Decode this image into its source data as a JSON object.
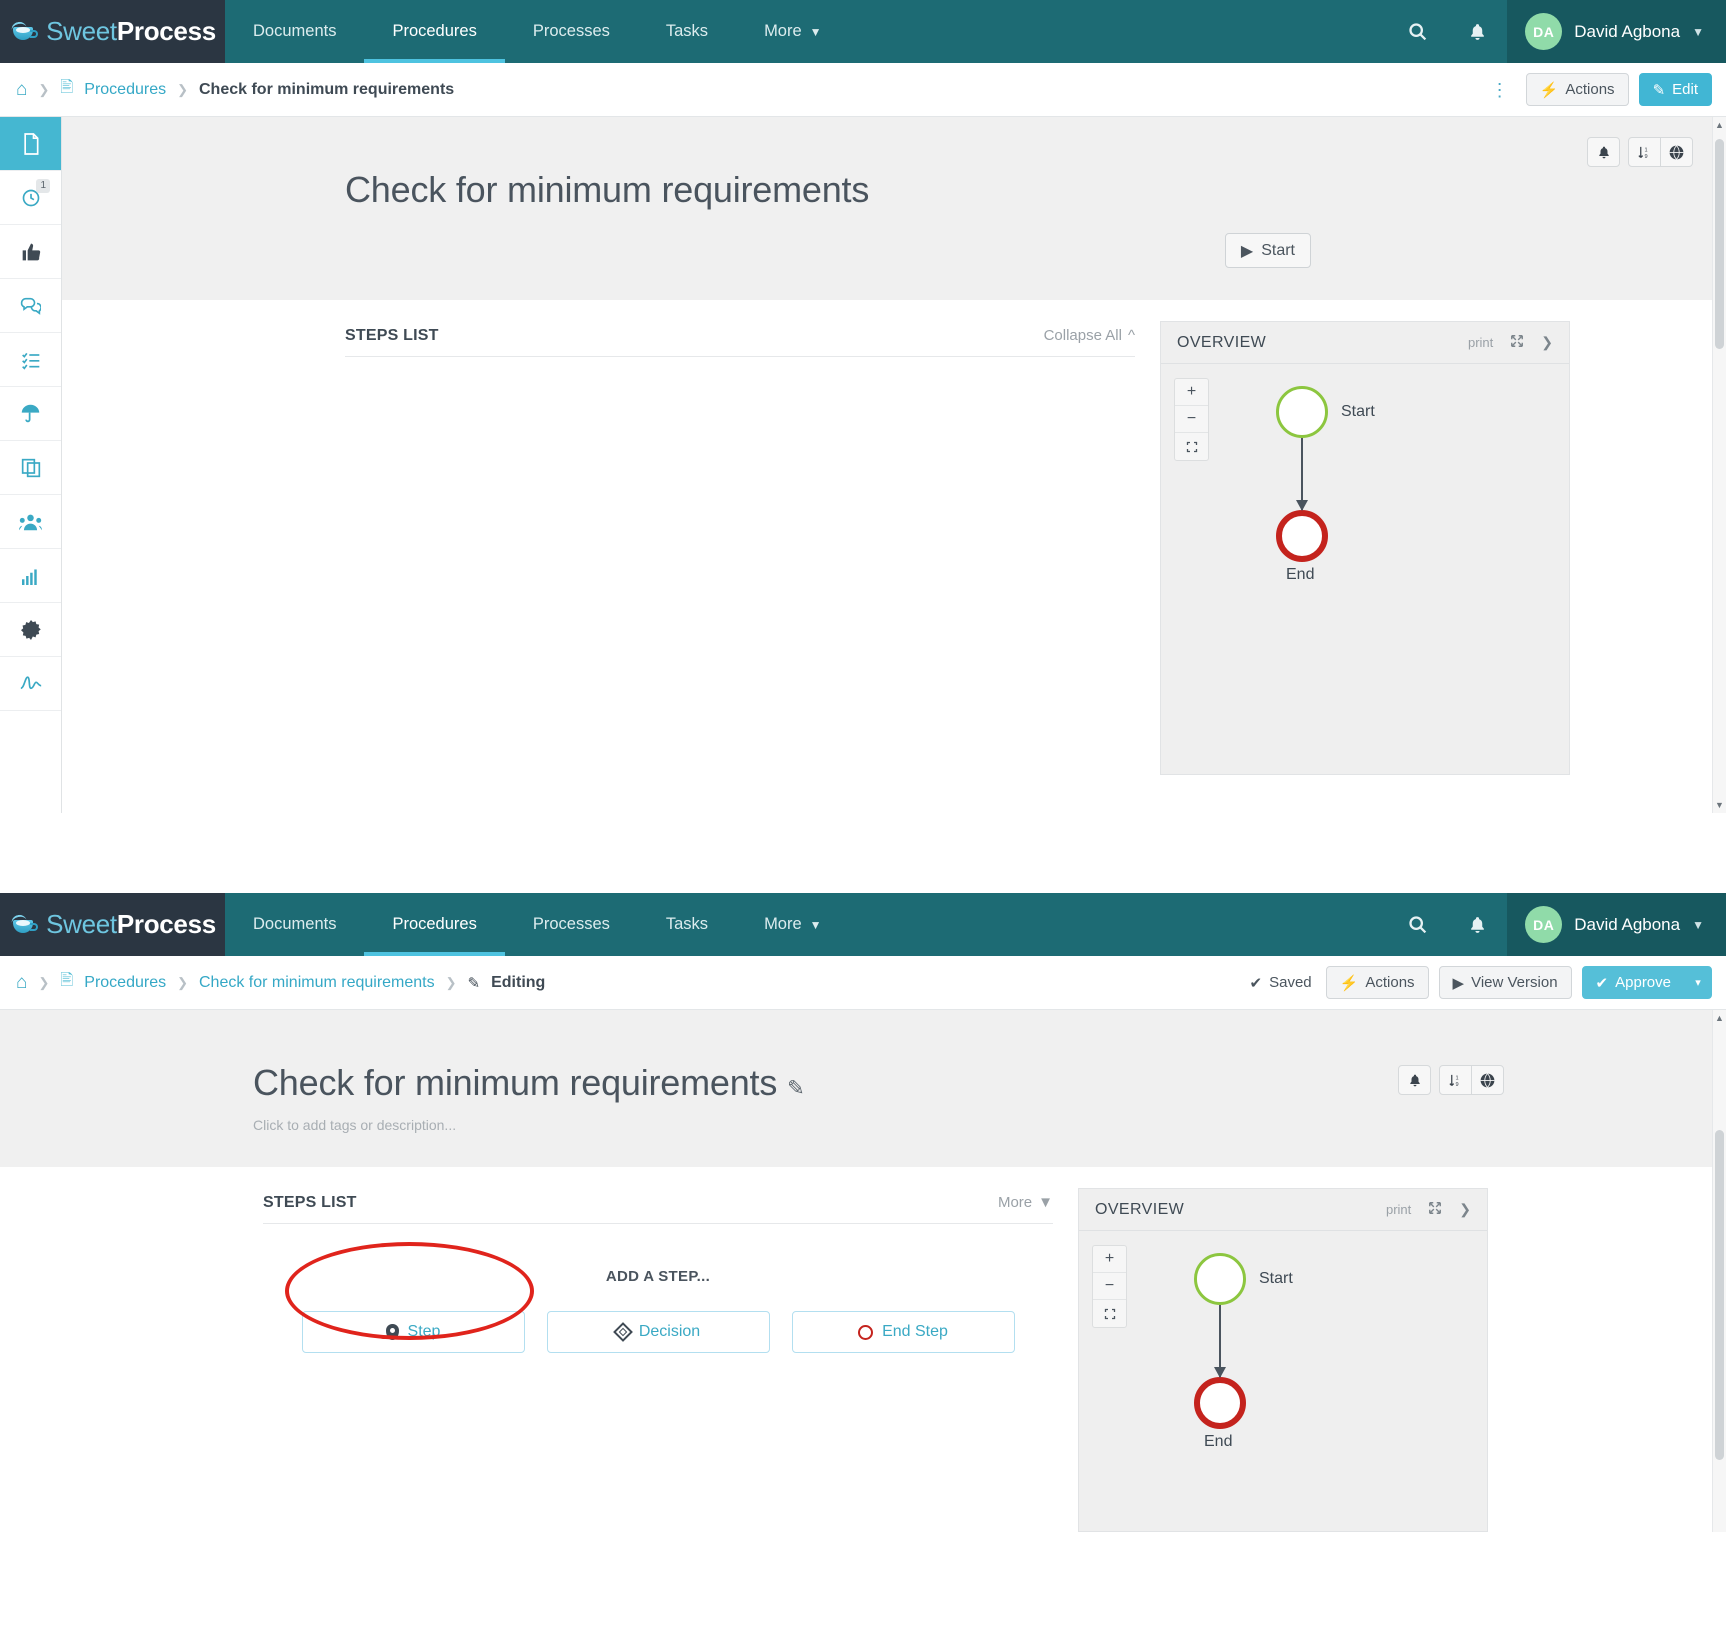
{
  "brand": {
    "sweet": "Sweet",
    "process": "Process",
    "mark": "coffee-cup-logo"
  },
  "nav": {
    "links": [
      {
        "label": "Documents",
        "active": false
      },
      {
        "label": "Procedures",
        "active": true
      },
      {
        "label": "Processes",
        "active": false
      },
      {
        "label": "Tasks",
        "active": false
      },
      {
        "label": "More",
        "active": false,
        "caret": "⌄"
      }
    ],
    "search_icon": "search-icon",
    "bell_icon": "bell-icon",
    "user": {
      "initials": "DA",
      "name": "David Agbona",
      "caret": "⌄"
    }
  },
  "sidebar": {
    "items": [
      {
        "name": "documents",
        "glyph": "📄",
        "active": true,
        "badge": ""
      },
      {
        "name": "history",
        "glyph": "◴",
        "active": false,
        "badge": "1"
      },
      {
        "name": "approvals",
        "glyph": "👍",
        "active": false,
        "badge": ""
      },
      {
        "name": "comments",
        "glyph": "💬",
        "active": false,
        "badge": ""
      },
      {
        "name": "checklist",
        "glyph": "☰",
        "active": false,
        "badge": ""
      },
      {
        "name": "umbrella",
        "glyph": "☂",
        "active": false,
        "badge": ""
      },
      {
        "name": "duplicate",
        "glyph": "❐",
        "active": false,
        "badge": ""
      },
      {
        "name": "teams",
        "glyph": "👥",
        "active": false,
        "badge": ""
      },
      {
        "name": "reports",
        "glyph": "📶",
        "active": false,
        "badge": ""
      },
      {
        "name": "settings",
        "glyph": "⚙",
        "active": false,
        "badge": ""
      },
      {
        "name": "signature",
        "glyph": "∿",
        "active": false,
        "badge": ""
      }
    ]
  },
  "view_panel": {
    "breadcrumb": {
      "home": "⌂",
      "doc_icon": "📄",
      "link": "Procedures",
      "current": "Check for minimum requirements"
    },
    "actions": {
      "kebab": "⋮",
      "actions_label": "Actions",
      "actions_icon": "bolt-icon",
      "edit_label": "Edit",
      "edit_icon": "pencil-square-icon"
    },
    "tools": [
      {
        "name": "notify",
        "glyph": "🔔"
      },
      {
        "name": "sort",
        "glyph": "↓"
      },
      {
        "name": "globe",
        "glyph": "🌐"
      }
    ],
    "title": "Check for minimum requirements",
    "start_button": "Start",
    "steps": {
      "title": "STEPS LIST",
      "action": "Collapse All",
      "caret": "⌃"
    },
    "overview": {
      "title": "OVERVIEW",
      "print": "print",
      "expand_icon": "expand-icon",
      "next_icon": "chevron-right-icon",
      "zoom_in": "+",
      "zoom_out": "−",
      "fit": "⛶",
      "start_label": "Start",
      "end_label": "End"
    }
  },
  "edit_panel": {
    "breadcrumb": {
      "home": "⌂",
      "doc_icon": "📄",
      "link": "Procedures",
      "doc_link": "Check for minimum requirements",
      "editing_icon": "✎",
      "editing": "Editing"
    },
    "actions": {
      "saved_check": "✔",
      "saved": "Saved",
      "actions_label": "Actions",
      "view_version_label": "View Version",
      "approve_label": "Approve",
      "approve_caret": "▾"
    },
    "tools": [
      {
        "name": "notify",
        "glyph": "🔔"
      },
      {
        "name": "sort",
        "glyph": "↓"
      },
      {
        "name": "globe",
        "glyph": "🌐"
      }
    ],
    "title": "Check for minimum requirements",
    "title_edit_icon": "✎",
    "tagline": "Click to add tags or description...",
    "steps": {
      "title": "STEPS LIST",
      "action": "More",
      "caret": "⌄"
    },
    "add_step": {
      "label": "ADD A STEP...",
      "buttons": [
        {
          "label": "Step",
          "icon": "map-pin-icon"
        },
        {
          "label": "Decision",
          "icon": "diamond-icon"
        },
        {
          "label": "End Step",
          "icon": "end-circle-icon"
        }
      ]
    },
    "overview": {
      "title": "OVERVIEW",
      "print": "print",
      "expand_icon": "expand-icon",
      "next_icon": "chevron-right-icon",
      "zoom_in": "+",
      "zoom_out": "−",
      "fit": "⛶",
      "start_label": "Start",
      "end_label": "End"
    }
  },
  "annotations": {
    "highlight_rect": "red-rectangle-around-actions-edit",
    "highlight_ellipse": "red-ellipse-around-step-button",
    "color": "#e3241b"
  }
}
